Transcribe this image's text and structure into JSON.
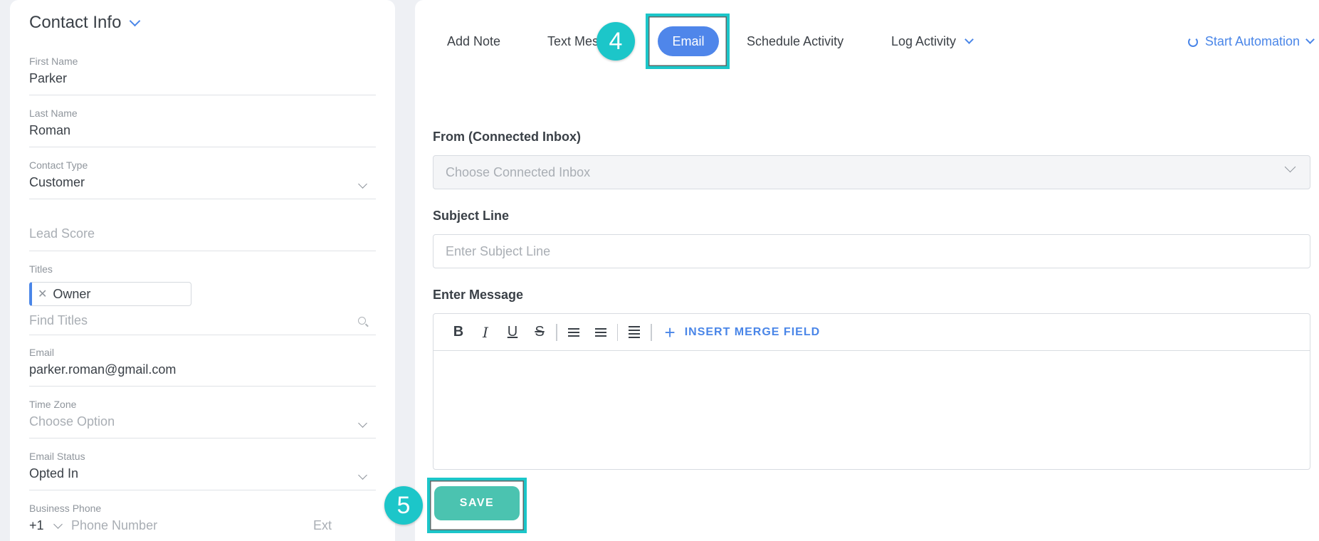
{
  "contact": {
    "title": "Contact Info",
    "first_name_label": "First Name",
    "first_name": "Parker",
    "last_name_label": "Last Name",
    "last_name": "Roman",
    "contact_type_label": "Contact Type",
    "contact_type": "Customer",
    "lead_score_placeholder": "Lead Score",
    "titles_label": "Titles",
    "title_tag": "Owner",
    "find_titles_placeholder": "Find Titles",
    "email_label": "Email",
    "email": "parker.roman@gmail.com",
    "time_zone_label": "Time Zone",
    "time_zone_placeholder": "Choose Option",
    "email_status_label": "Email Status",
    "email_status": "Opted In",
    "business_phone_label": "Business Phone",
    "phone_code": "+1",
    "phone_placeholder": "Phone Number",
    "ext_placeholder": "Ext"
  },
  "tabs": {
    "add_note": "Add Note",
    "text_message": "Text Mes",
    "email": "Email",
    "schedule_activity": "Schedule Activity",
    "log_activity": "Log Activity",
    "start_automation": "Start Automation"
  },
  "badges": {
    "step4": "4",
    "step5": "5"
  },
  "form": {
    "from_label": "From (Connected Inbox)",
    "from_placeholder": "Choose Connected Inbox",
    "subject_label": "Subject Line",
    "subject_placeholder": "Enter Subject Line",
    "message_label": "Enter Message",
    "merge_field": "INSERT MERGE FIELD",
    "save": "SAVE"
  },
  "toolbar": {
    "bold": "B",
    "italic": "I",
    "underline": "U",
    "strike": "S"
  },
  "colors": {
    "accent": "#4a86e8",
    "highlight": "#1cc6c9",
    "save": "#4bc3b0"
  }
}
